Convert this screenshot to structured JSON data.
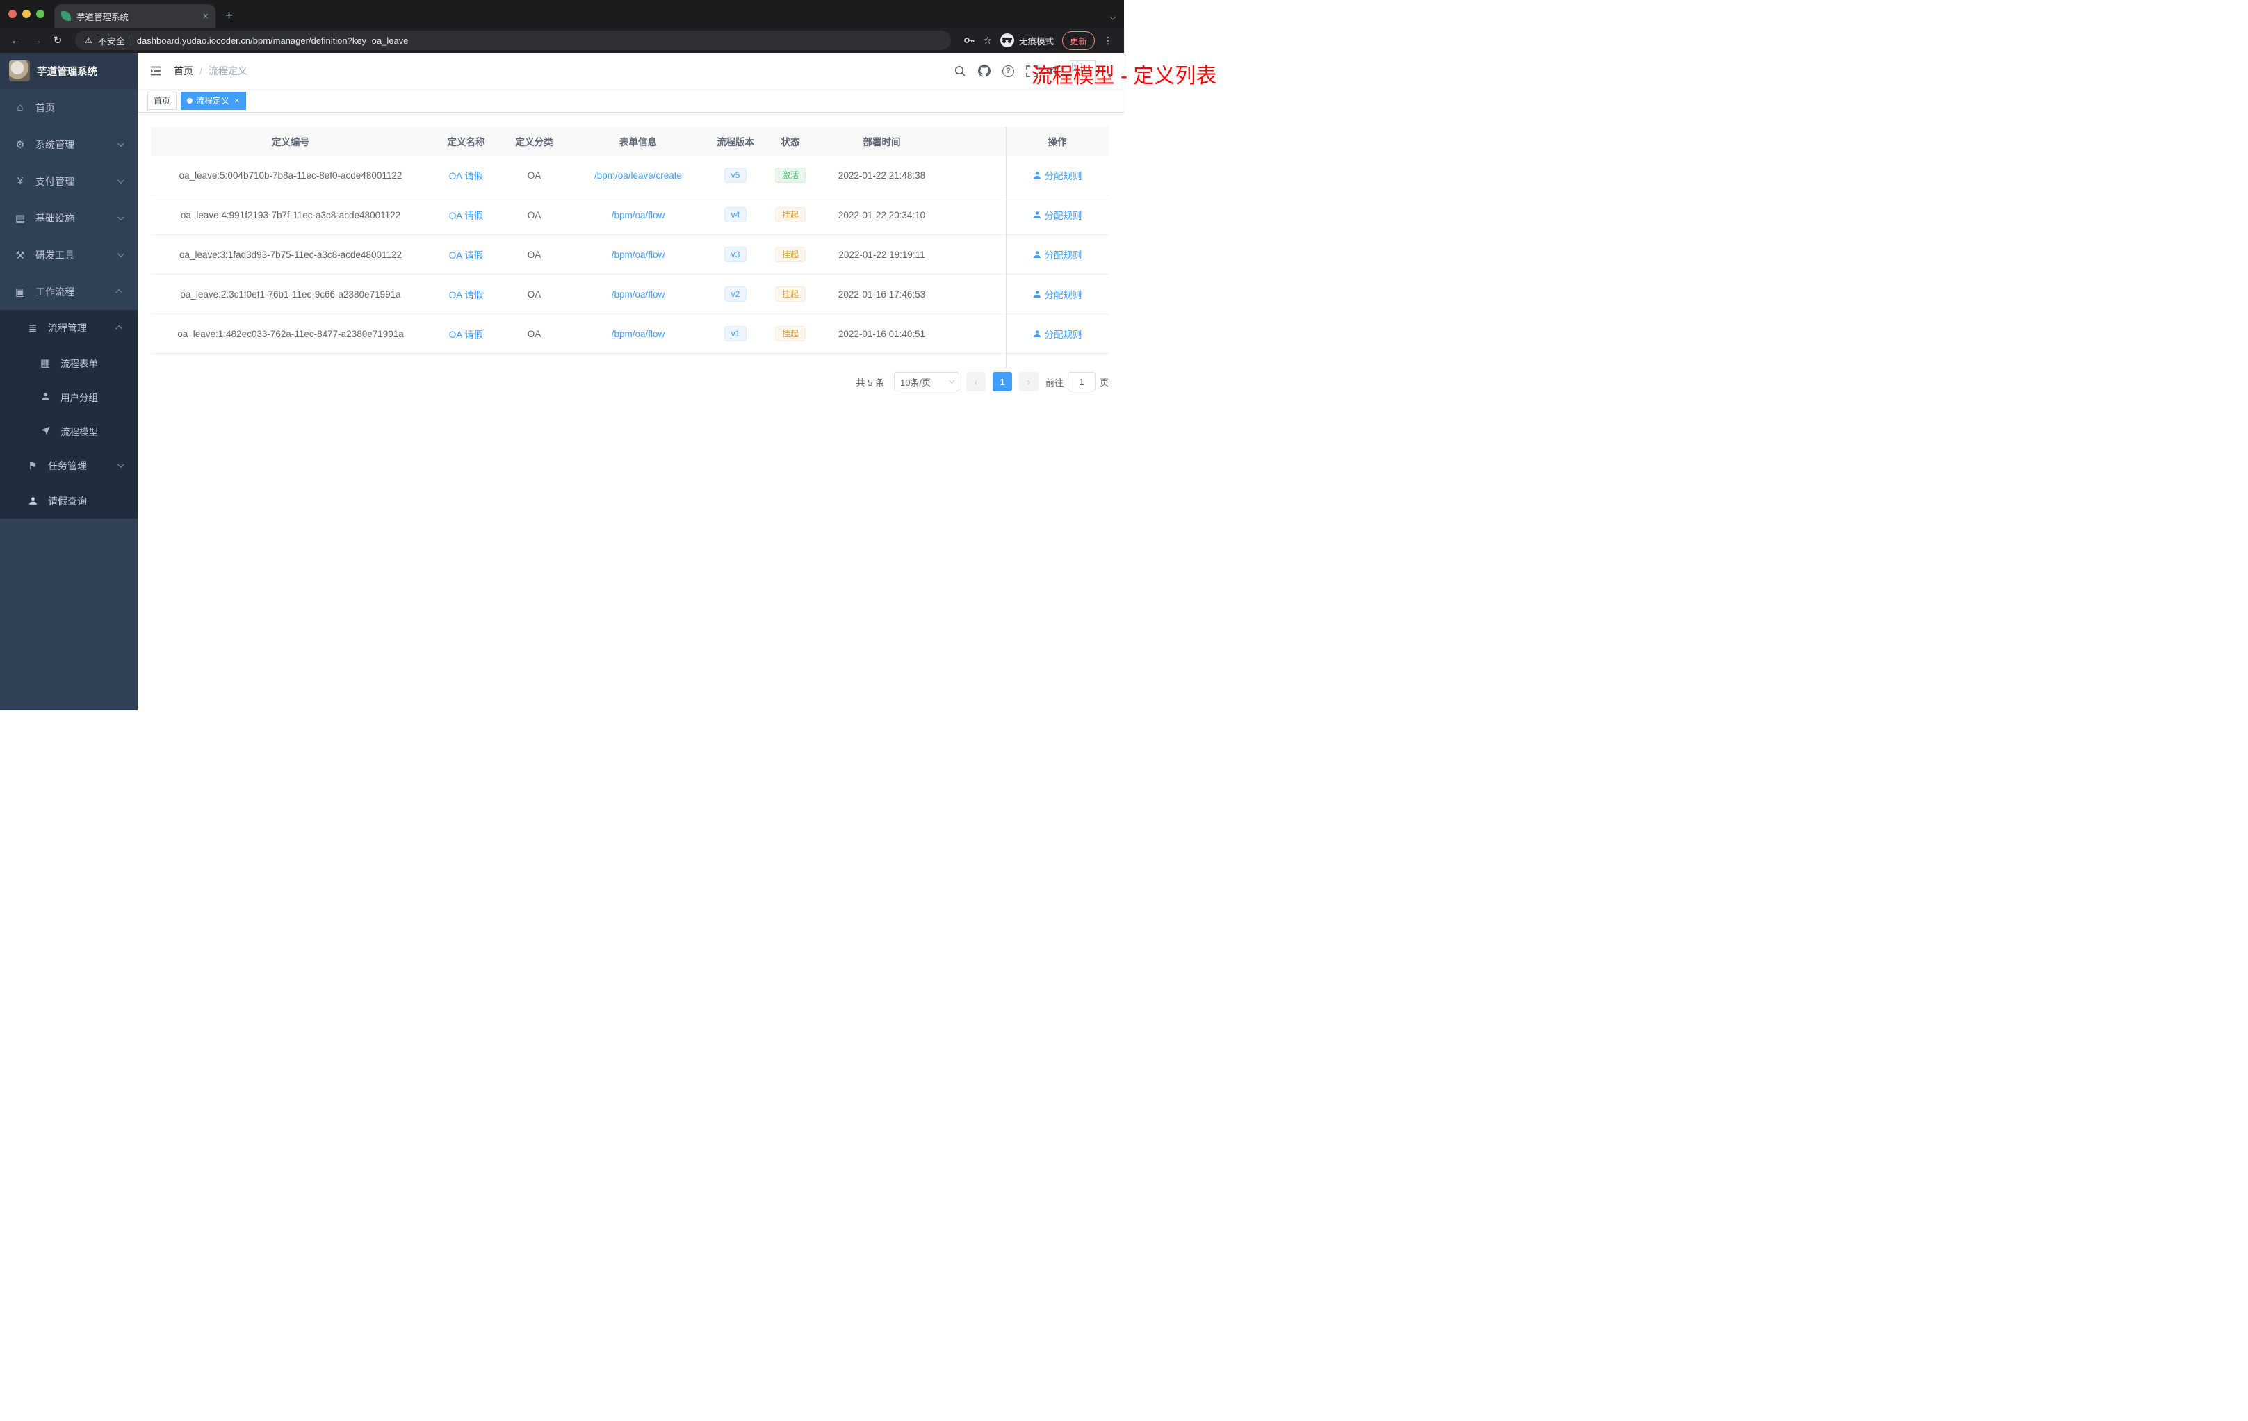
{
  "browser": {
    "tab_title": "芋道管理系统",
    "new_tab_label": "+",
    "back": "←",
    "forward": "→",
    "reload": "↻",
    "warn_icon": "⚠",
    "security_label": "不安全",
    "url": "dashboard.yudao.iocoder.cn/bpm/manager/definition?key=oa_leave",
    "star": "☆",
    "incognito_label": "无痕模式",
    "update_label": "更新",
    "kebab": "⋮"
  },
  "sidebar": {
    "logo_title": "芋道管理系统",
    "items": [
      {
        "label": "首页"
      },
      {
        "label": "系统管理"
      },
      {
        "label": "支付管理"
      },
      {
        "label": "基础设施"
      },
      {
        "label": "研发工具"
      },
      {
        "label": "工作流程"
      },
      {
        "label": "流程管理"
      },
      {
        "label": "流程表单"
      },
      {
        "label": "用户分组"
      },
      {
        "label": "流程模型"
      },
      {
        "label": "任务管理"
      },
      {
        "label": "请假查询"
      }
    ]
  },
  "header": {
    "breadcrumb": {
      "home": "首页",
      "separator": "/",
      "current": "流程定义"
    },
    "overlay_title": "流程模型 - 定义列表",
    "font_size_icon_label": "tT",
    "help_glyph": "?"
  },
  "tags": {
    "home": "首页",
    "active": "流程定义",
    "close": "×"
  },
  "table": {
    "columns": [
      "定义编号",
      "定义名称",
      "定义分类",
      "表单信息",
      "流程版本",
      "状态",
      "部署时间",
      "操作"
    ],
    "rows": [
      {
        "id": "oa_leave:5:004b710b-7b8a-11ec-8ef0-acde48001122",
        "name": "OA 请假",
        "category": "OA",
        "form": "/bpm/oa/leave/create",
        "version": "v5",
        "status": "激活",
        "deployed_at": "2022-01-22 21:48:38",
        "action": "分配规则"
      },
      {
        "id": "oa_leave:4:991f2193-7b7f-11ec-a3c8-acde48001122",
        "name": "OA 请假",
        "category": "OA",
        "form": "/bpm/oa/flow",
        "version": "v4",
        "status": "挂起",
        "deployed_at": "2022-01-22 20:34:10",
        "action": "分配规则"
      },
      {
        "id": "oa_leave:3:1fad3d93-7b75-11ec-a3c8-acde48001122",
        "name": "OA 请假",
        "category": "OA",
        "form": "/bpm/oa/flow",
        "version": "v3",
        "status": "挂起",
        "deployed_at": "2022-01-22 19:19:11",
        "action": "分配规则"
      },
      {
        "id": "oa_leave:2:3c1f0ef1-76b1-11ec-9c66-a2380e71991a",
        "name": "OA 请假",
        "category": "OA",
        "form": "/bpm/oa/flow",
        "version": "v2",
        "status": "挂起",
        "deployed_at": "2022-01-16 17:46:53",
        "action": "分配规则"
      },
      {
        "id": "oa_leave:1:482ec033-762a-11ec-8477-a2380e71991a",
        "name": "OA 请假",
        "category": "OA",
        "form": "/bpm/oa/flow",
        "version": "v1",
        "status": "挂起",
        "deployed_at": "2022-01-16 01:40:51",
        "action": "分配规则"
      }
    ]
  },
  "pagination": {
    "total": "共 5 条",
    "page_size": "10条/页",
    "prev": "‹",
    "next": "›",
    "current_page": "1",
    "goto_label": "前往",
    "goto_value": "1",
    "goto_unit": "页"
  },
  "colors": {
    "accent": "#409eff",
    "annotation_red": "#fb0000",
    "status_active_green": "#4cb96f",
    "status_suspended_orange": "#e6a23c",
    "sidebar_bg": "#304156",
    "submenu_bg": "#1f2d3d"
  }
}
